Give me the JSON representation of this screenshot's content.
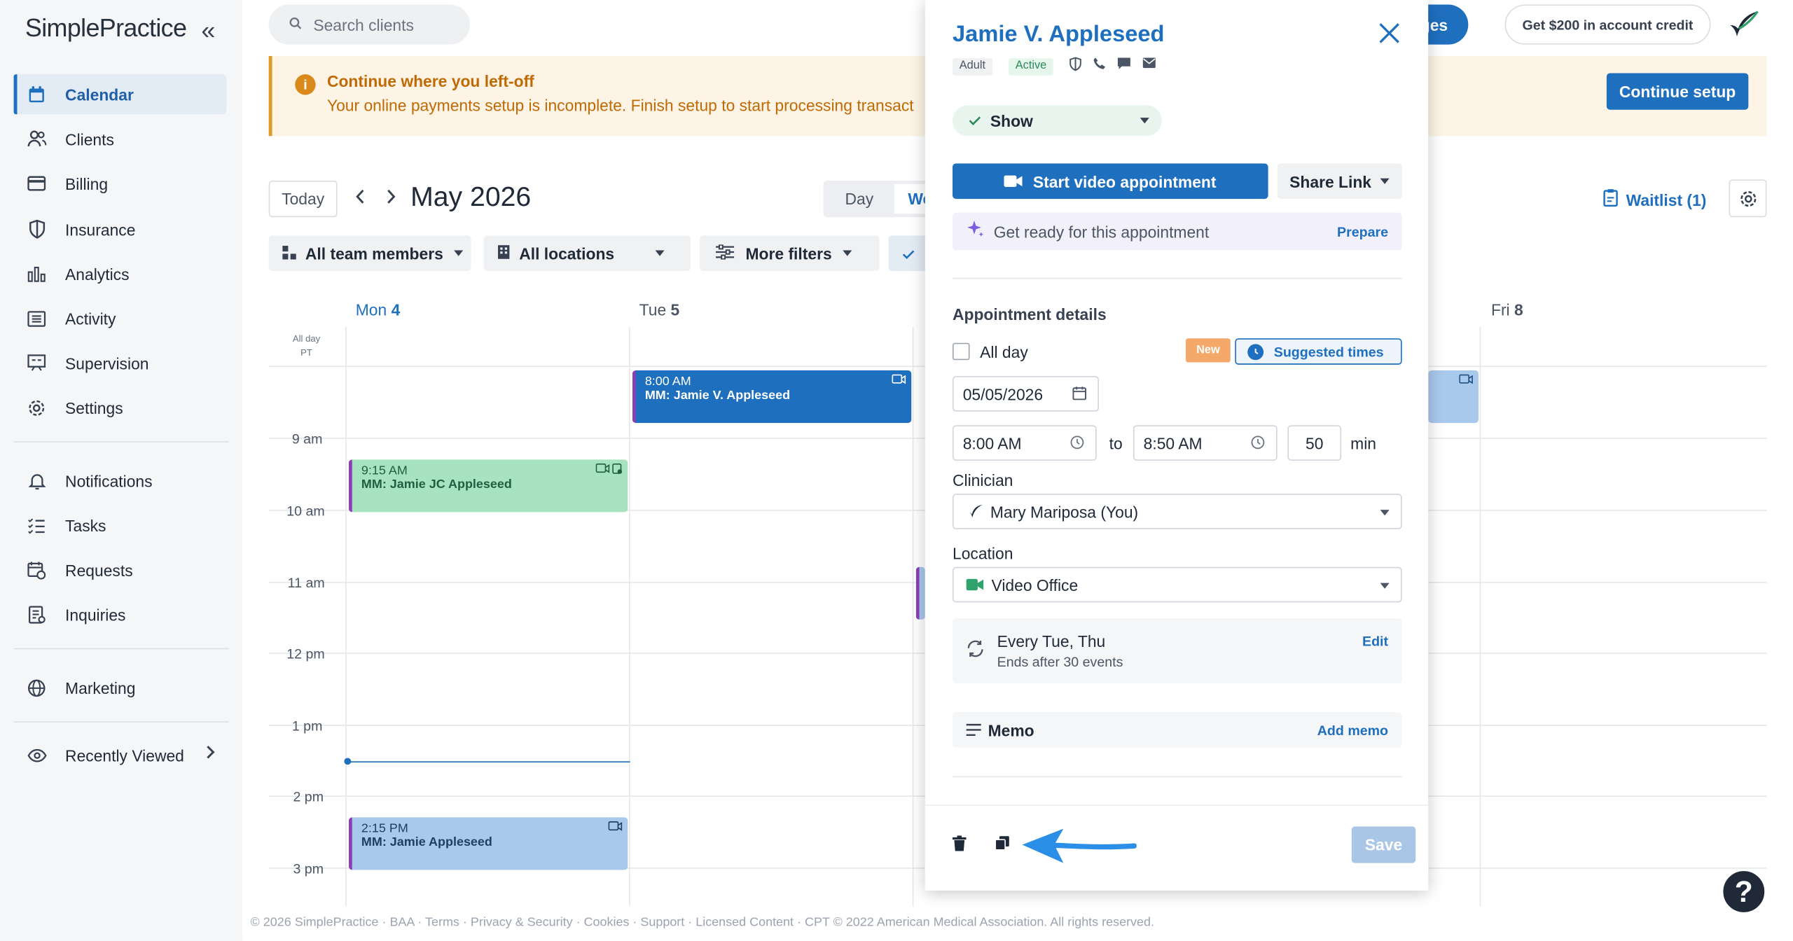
{
  "sidebar": {
    "logo": "SimplePractice",
    "collapse_icon": "«",
    "items": [
      {
        "label": "Calendar",
        "icon": "calendar-icon",
        "active": true
      },
      {
        "label": "Clients",
        "icon": "users-icon"
      },
      {
        "label": "Billing",
        "icon": "credit-card-icon"
      },
      {
        "label": "Insurance",
        "icon": "shield-icon"
      },
      {
        "label": "Analytics",
        "icon": "bar-chart-icon"
      },
      {
        "label": "Activity",
        "icon": "activity-list-icon"
      },
      {
        "label": "Supervision",
        "icon": "supervision-icon"
      },
      {
        "label": "Settings",
        "icon": "gear-icon"
      },
      {
        "label": "Notifications",
        "icon": "bell-icon"
      },
      {
        "label": "Tasks",
        "icon": "checklist-icon"
      },
      {
        "label": "Requests",
        "icon": "calendar-request-icon"
      },
      {
        "label": "Inquiries",
        "icon": "inquiry-icon"
      },
      {
        "label": "Marketing",
        "icon": "globe-icon"
      },
      {
        "label": "Recently Viewed",
        "icon": "eye-icon"
      }
    ]
  },
  "topbar": {
    "search_placeholder": "Search clients",
    "truncated_button": "ges",
    "credit_button": "Get $200 in account credit"
  },
  "banner": {
    "title": "Continue where you left-off",
    "text": "Your online payments setup is incomplete. Finish setup to start processing transact",
    "button": "Continue setup"
  },
  "calendar": {
    "today_button": "Today",
    "month": "May 2026",
    "view_day": "Day",
    "view_week": "We",
    "waitlist": "Waitlist (1)",
    "filters": [
      "All team members",
      "All locations",
      "More filters"
    ],
    "days": [
      {
        "name": "Mon",
        "num": "4"
      },
      {
        "name": "Tue",
        "num": "5"
      },
      {
        "name": "Fri",
        "num": "8"
      }
    ],
    "allday_label": "All day",
    "tz_label": "PT",
    "times": [
      "9 am",
      "10 am",
      "11 am",
      "12 pm",
      "1 pm",
      "2 pm",
      "3 pm"
    ],
    "events": [
      {
        "time": "9:15 AM",
        "title": "MM: Jamie JC Appleseed"
      },
      {
        "time": "8:00 AM",
        "title": "MM: Jamie V. Appleseed"
      },
      {
        "time": "2:15 PM",
        "title": "MM: Jamie Appleseed"
      }
    ]
  },
  "footer": "© 2026 SimplePractice · BAA · Terms · Privacy & Security · Cookies · Support · Licensed Content · CPT © 2022 American Medical Association. All rights reserved.",
  "help": "?",
  "panel": {
    "client_name": "Jamie V. Appleseed",
    "tags": [
      "Adult",
      "Active"
    ],
    "status": "Show",
    "video_button": "Start video appointment",
    "share_button": "Share Link",
    "ready_text": "Get ready for this appointment",
    "prepare_link": "Prepare",
    "details_heading": "Appointment details",
    "allday_label": "All day",
    "new_tag": "New",
    "suggested_times": "Suggested times",
    "date": "05/05/2026",
    "start_time": "8:00 AM",
    "to_label": "to",
    "end_time": "8:50 AM",
    "duration": "50",
    "min_label": "min",
    "clinician_label": "Clinician",
    "clinician": "Mary Mariposa (You)",
    "location_label": "Location",
    "location": "Video Office",
    "recurrence": "Every Tue, Thu",
    "recurrence_end": "Ends after 30 events",
    "edit_link": "Edit",
    "memo_label": "Memo",
    "add_memo": "Add memo",
    "save_button": "Save"
  }
}
